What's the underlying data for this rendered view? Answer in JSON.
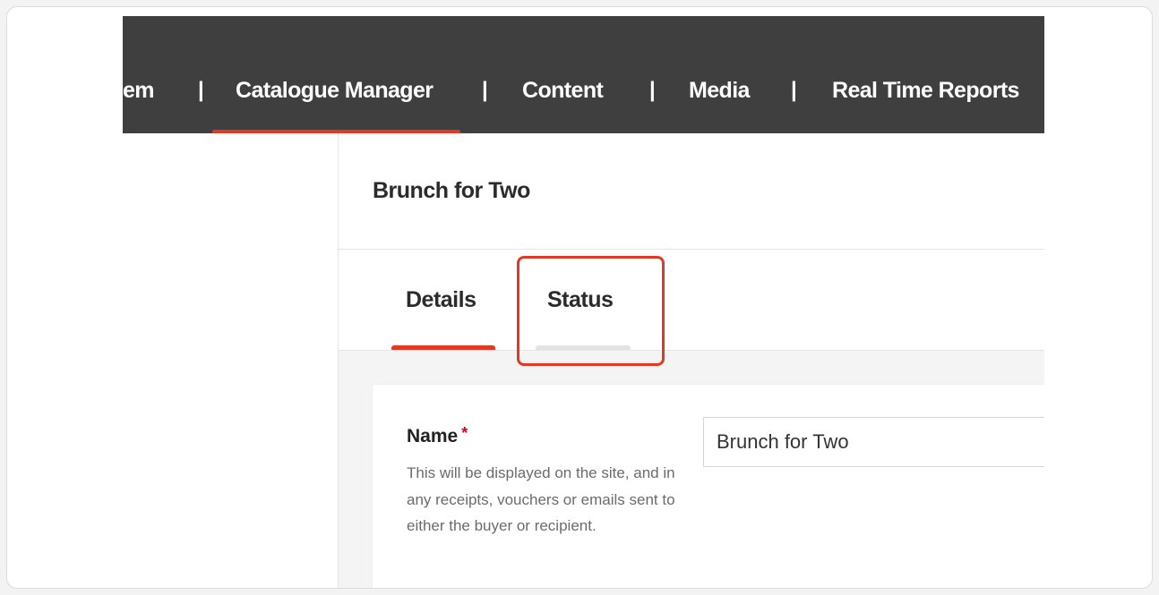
{
  "nav": {
    "items": [
      {
        "label": "em"
      },
      {
        "label": "Catalogue Manager"
      },
      {
        "label": "Content"
      },
      {
        "label": "Media"
      },
      {
        "label": "Real Time Reports"
      }
    ],
    "separator": "|"
  },
  "page": {
    "title": "Brunch for Two"
  },
  "tabs": [
    {
      "label": "Details",
      "active": true
    },
    {
      "label": "Status",
      "active": false
    }
  ],
  "form": {
    "name_label": "Name",
    "required_marker": "*",
    "name_help": "This will be displayed on the site, and in any receipts, vouchers or emails sent to either the buyer or recipient.",
    "name_value": "Brunch for Two"
  },
  "colors": {
    "accent": "#e03a26",
    "navbar": "#3f3f3f",
    "required": "#d0021b"
  }
}
